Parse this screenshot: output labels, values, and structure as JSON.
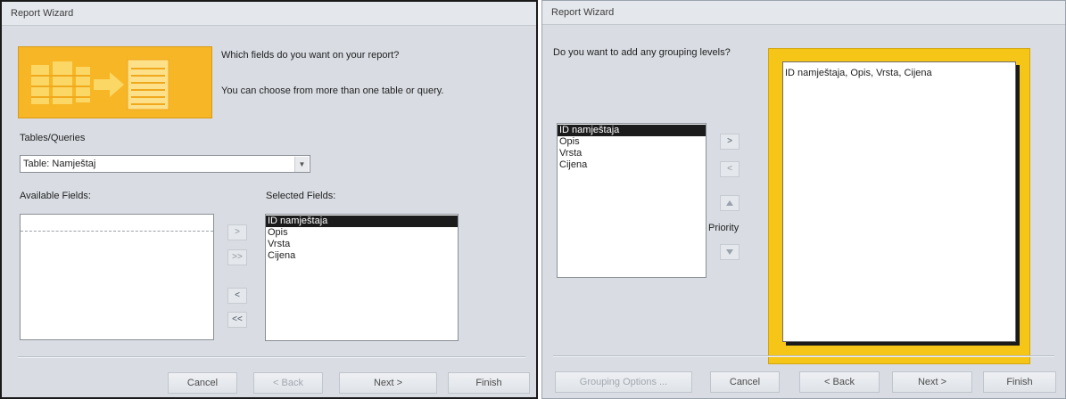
{
  "dialog1": {
    "title": "Report Wizard",
    "question": "Which fields do you want on your report?",
    "hint": "You can choose from more than one table or query.",
    "tables_label": "Tables/Queries",
    "table_value": "Table: Namještaj",
    "available_label": "Available Fields:",
    "selected_label": "Selected Fields:",
    "selected_fields": [
      "ID namještaja",
      "Opis",
      "Vrsta",
      "Cijena"
    ],
    "move_buttons": [
      ">",
      ">>",
      "<",
      "<<"
    ],
    "buttons": {
      "cancel": "Cancel",
      "back": "< Back",
      "next": "Next >",
      "finish": "Finish"
    }
  },
  "dialog2": {
    "title": "Report Wizard",
    "question": "Do you want to add any grouping levels?",
    "fields": [
      "ID namještaja",
      "Opis",
      "Vrsta",
      "Cijena"
    ],
    "move_buttons": [
      ">",
      "<"
    ],
    "priority_label": "Priority",
    "preview_text": "ID namještaja, Opis, Vrsta, Cijena",
    "buttons": {
      "grouping_options": "Grouping Options ...",
      "cancel": "Cancel",
      "back": "< Back",
      "next": "Next >",
      "finish": "Finish"
    }
  },
  "colors": {
    "accent": "#f5c518",
    "selection": "#1b1b1b",
    "dialog_bg": "#d9dde3"
  },
  "icons": {
    "wizard_banner": "fields-to-report-icon",
    "priority_up": "up-arrow-icon",
    "priority_down": "down-arrow-icon"
  }
}
